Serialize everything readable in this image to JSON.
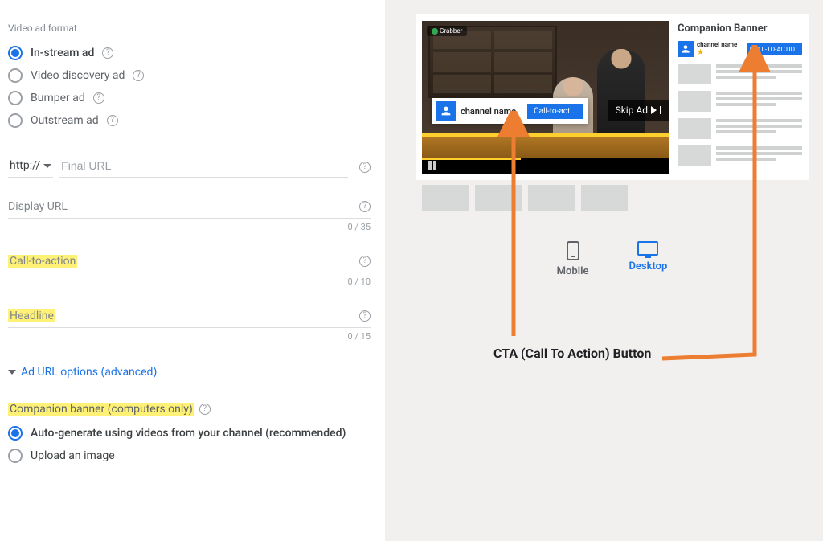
{
  "formatSection": {
    "label": "Video ad format",
    "options": [
      {
        "id": "instream",
        "label": "In-stream ad",
        "selected": true,
        "help": true
      },
      {
        "id": "discovery",
        "label": "Video discovery ad",
        "selected": false,
        "help": true
      },
      {
        "id": "bumper",
        "label": "Bumper ad",
        "selected": false,
        "help": true
      },
      {
        "id": "outstream",
        "label": "Outstream ad",
        "selected": false,
        "help": true
      }
    ]
  },
  "urlRow": {
    "protocol": "http://",
    "finalUrlPlaceholder": "Final URL"
  },
  "displayUrl": {
    "label": "Display URL",
    "counter": "0 / 35"
  },
  "cta": {
    "label": "Call-to-action",
    "counter": "0 / 10"
  },
  "headline": {
    "label": "Headline",
    "counter": "0 / 15"
  },
  "adUrlOptions": "Ad URL options (advanced)",
  "companion": {
    "label": "Companion banner (computers only)",
    "options": [
      {
        "id": "autogen",
        "label": "Auto-generate using videos from your channel (recommended)",
        "selected": true
      },
      {
        "id": "upload",
        "label": "Upload an image",
        "selected": false
      }
    ]
  },
  "preview": {
    "grabberBadge": "Grabber",
    "channelName": "channel name",
    "overlayCta": "Call-to-acti…",
    "skipAd": "Skip Ad",
    "companionTitle": "Companion Banner",
    "companionChannel": "channel name",
    "companionCta": "CALL-TO-ACTIO…"
  },
  "deviceToggle": {
    "mobile": "Mobile",
    "desktop": "Desktop"
  },
  "annotation": "CTA (Call To Action) Button"
}
